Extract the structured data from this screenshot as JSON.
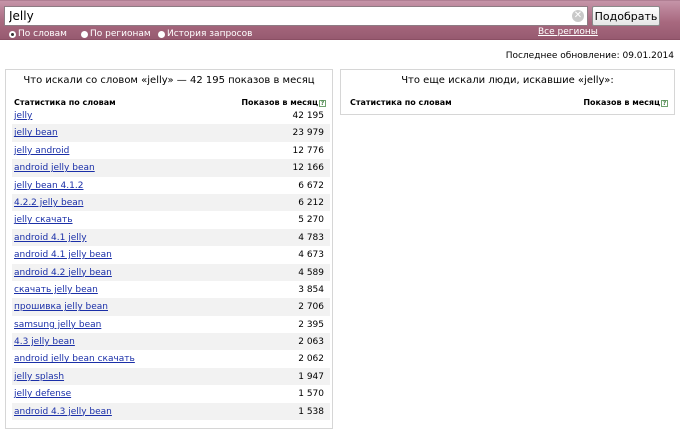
{
  "search": {
    "value": "Jelly",
    "clear_glyph": "✕",
    "button_label": "Подобрать"
  },
  "modes": [
    {
      "label": "По словам",
      "selected": true
    },
    {
      "label": "По регионам",
      "selected": false
    },
    {
      "label": "История запросов",
      "selected": false
    }
  ],
  "regions_link": "Все регионы",
  "last_update": "Последнее обновление: 09.01.2014",
  "left_panel": {
    "title": "Что искали со словом «jelly» — 42 195 показов в месяц",
    "col_keywords": "Статистика по словам",
    "col_shows": "Показов в месяц",
    "help_glyph": "?",
    "rows": [
      {
        "keyword": "jelly",
        "count": "42 195"
      },
      {
        "keyword": "jelly bean",
        "count": "23 979"
      },
      {
        "keyword": "jelly android",
        "count": "12 776"
      },
      {
        "keyword": "android jelly bean",
        "count": "12 166"
      },
      {
        "keyword": "jelly bean 4.1.2",
        "count": "6 672"
      },
      {
        "keyword": "4.2.2 jelly bean",
        "count": "6 212"
      },
      {
        "keyword": "jelly скачать",
        "count": "5 270"
      },
      {
        "keyword": "android 4.1 jelly",
        "count": "4 783"
      },
      {
        "keyword": "android 4.1 jelly bean",
        "count": "4 673"
      },
      {
        "keyword": "android 4.2 jelly bean",
        "count": "4 589"
      },
      {
        "keyword": "скачать jelly bean",
        "count": "3 854"
      },
      {
        "keyword": "прошивка jelly bean",
        "count": "2 706"
      },
      {
        "keyword": "samsung jelly bean",
        "count": "2 395"
      },
      {
        "keyword": "4.3 jelly bean",
        "count": "2 063"
      },
      {
        "keyword": "android jelly bean скачать",
        "count": "2 062"
      },
      {
        "keyword": "jelly splash",
        "count": "1 947"
      },
      {
        "keyword": "jelly defense",
        "count": "1 570"
      },
      {
        "keyword": "android 4.3 jelly bean",
        "count": "1 538"
      }
    ]
  },
  "right_panel": {
    "title": "Что еще искали люди, искавшие «jelly»:",
    "col_keywords": "Статистика по словам",
    "col_shows": "Показов в месяц",
    "help_glyph": "?"
  }
}
